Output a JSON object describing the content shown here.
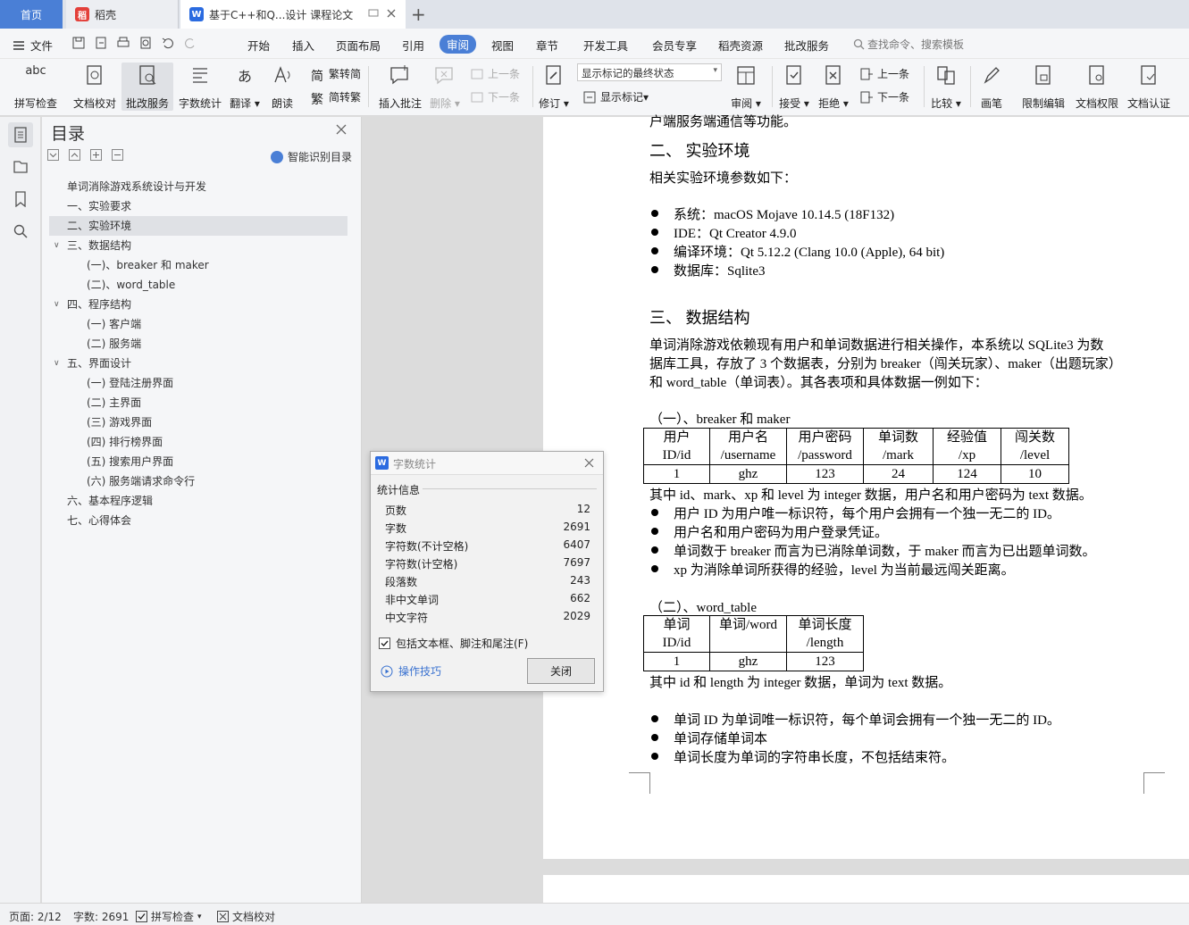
{
  "tabs": {
    "home": "首页",
    "daoke": "稻壳",
    "doc": "基于C++和Q...设计 课程论文"
  },
  "menu": {
    "file": "文件",
    "items": [
      "开始",
      "插入",
      "页面布局",
      "引用",
      "审阅",
      "视图",
      "章节",
      "开发工具",
      "会员专享",
      "稻壳资源",
      "批改服务"
    ],
    "search": "查找命令、搜索模板"
  },
  "ribbon": {
    "spell": "拼写检查",
    "proof": "文档校对",
    "correct": "批改服务",
    "wordcount": "字数统计",
    "translate": "翻译",
    "read": "朗读",
    "trad": "繁转简",
    "simp": "简转繁",
    "insert_comment": "插入批注",
    "delete": "删除",
    "prev1": "上一条",
    "next1": "下一条",
    "revise": "修订",
    "markup_select": "显示标记的最终状态",
    "show_markup": "显示标记",
    "review": "审阅",
    "accept": "接受",
    "reject": "拒绝",
    "prev2": "上一条",
    "next2": "下一条",
    "compare": "比较",
    "pen": "画笔",
    "restrict": "限制编辑",
    "perm": "文档权限",
    "cert": "文档认证"
  },
  "toc": {
    "title": "目录",
    "smart": "智能识别目录",
    "items": [
      {
        "text": "单词消除游戏系统设计与开发",
        "lvl": 0,
        "tw": ""
      },
      {
        "text": "一、实验要求",
        "lvl": 1,
        "tw": ""
      },
      {
        "text": "二、实验环境",
        "lvl": 1,
        "tw": "",
        "sel": true
      },
      {
        "text": "三、数据结构",
        "lvl": 1,
        "tw": "v"
      },
      {
        "text": "(一)、breaker 和 maker",
        "lvl": 2,
        "tw": ""
      },
      {
        "text": "(二)、word_table",
        "lvl": 2,
        "tw": ""
      },
      {
        "text": "四、程序结构",
        "lvl": 1,
        "tw": "v"
      },
      {
        "text": "(一) 客户端",
        "lvl": 2,
        "tw": ""
      },
      {
        "text": "(二) 服务端",
        "lvl": 2,
        "tw": ""
      },
      {
        "text": "五、界面设计",
        "lvl": 1,
        "tw": "v"
      },
      {
        "text": "(一) 登陆注册界面",
        "lvl": 2,
        "tw": ""
      },
      {
        "text": "(二) 主界面",
        "lvl": 2,
        "tw": ""
      },
      {
        "text": "(三) 游戏界面",
        "lvl": 2,
        "tw": ""
      },
      {
        "text": "(四) 排行榜界面",
        "lvl": 2,
        "tw": ""
      },
      {
        "text": "(五) 搜索用户界面",
        "lvl": 2,
        "tw": ""
      },
      {
        "text": "(六) 服务端请求命令行",
        "lvl": 2,
        "tw": ""
      },
      {
        "text": "六、基本程序逻辑",
        "lvl": 1,
        "tw": ""
      },
      {
        "text": "七、心得体会",
        "lvl": 1,
        "tw": ""
      }
    ]
  },
  "doc": {
    "top_cut": "户端服务端通信等功能。",
    "h2": "二、  实验环境",
    "p_env": "相关实验环境参数如下：",
    "env": [
      "系统：macOS Mojave 10.14.5 (18F132)",
      "IDE：Qt Creator 4.9.0",
      "编译环境：Qt 5.12.2 (Clang 10.0 (Apple), 64 bit)",
      "数据库：Sqlite3"
    ],
    "h3": "三、  数据结构",
    "p_ds1": "单词消除游戏依赖现有用户和单词数据进行相关操作，本系统以 SQLite3 为数",
    "p_ds2": "据库工具，存放了 3 个数据表，分别为 breaker（闯关玩家）、maker（出题玩家）",
    "p_ds3": "和 word_table（单词表）。其各表项和具体数据一例如下：",
    "sub1": "（一）、breaker 和 maker",
    "t1_head1": [
      "用户",
      "用户名",
      "用户密码",
      "单词数",
      "经验值",
      "闯关数"
    ],
    "t1_head2": [
      "ID/id",
      "/username",
      "/password",
      "/mark",
      "/xp",
      "/level"
    ],
    "t1_row": [
      "1",
      "ghz",
      "123",
      "24",
      "124",
      "10"
    ],
    "p_t1": "其中 id、mark、xp 和 level 为 integer 数据，用户名和用户密码为 text 数据。",
    "b1": [
      "用户 ID 为用户唯一标识符，每个用户会拥有一个独一无二的 ID。",
      "用户名和用户密码为用户登录凭证。",
      "单词数于 breaker 而言为已消除单词数，于 maker 而言为已出题单词数。",
      "xp 为消除单词所获得的经验，level 为当前最远闯关距离。"
    ],
    "sub2": "（二）、word_table",
    "t2_head1": [
      "单词",
      "单词/word",
      "单词长度"
    ],
    "t2_head2": [
      "ID/id",
      "",
      "/length"
    ],
    "t2_row": [
      "1",
      "ghz",
      "123"
    ],
    "p_t2": "其中 id 和 length 为 integer 数据，单词为 text 数据。",
    "b2": [
      "单词 ID 为单词唯一标识符，每个单词会拥有一个独一无二的 ID。",
      "单词存储单词本",
      "单词长度为单词的字符串长度，不包括结束符。"
    ]
  },
  "dialog": {
    "title": "字数统计",
    "section": "统计信息",
    "stats": [
      {
        "label": "页数",
        "value": "12"
      },
      {
        "label": "字数",
        "value": "2691"
      },
      {
        "label": "字符数(不计空格)",
        "value": "6407"
      },
      {
        "label": "字符数(计空格)",
        "value": "7697"
      },
      {
        "label": "段落数",
        "value": "243"
      },
      {
        "label": "非中文单词",
        "value": "662"
      },
      {
        "label": "中文字符",
        "value": "2029"
      }
    ],
    "include": "包括文本框、脚注和尾注(F)",
    "tips": "操作技巧",
    "close": "关闭"
  },
  "status": {
    "page": "页面: 2/12",
    "words": "字数: 2691",
    "spell": "拼写检查",
    "proof": "文档校对"
  }
}
